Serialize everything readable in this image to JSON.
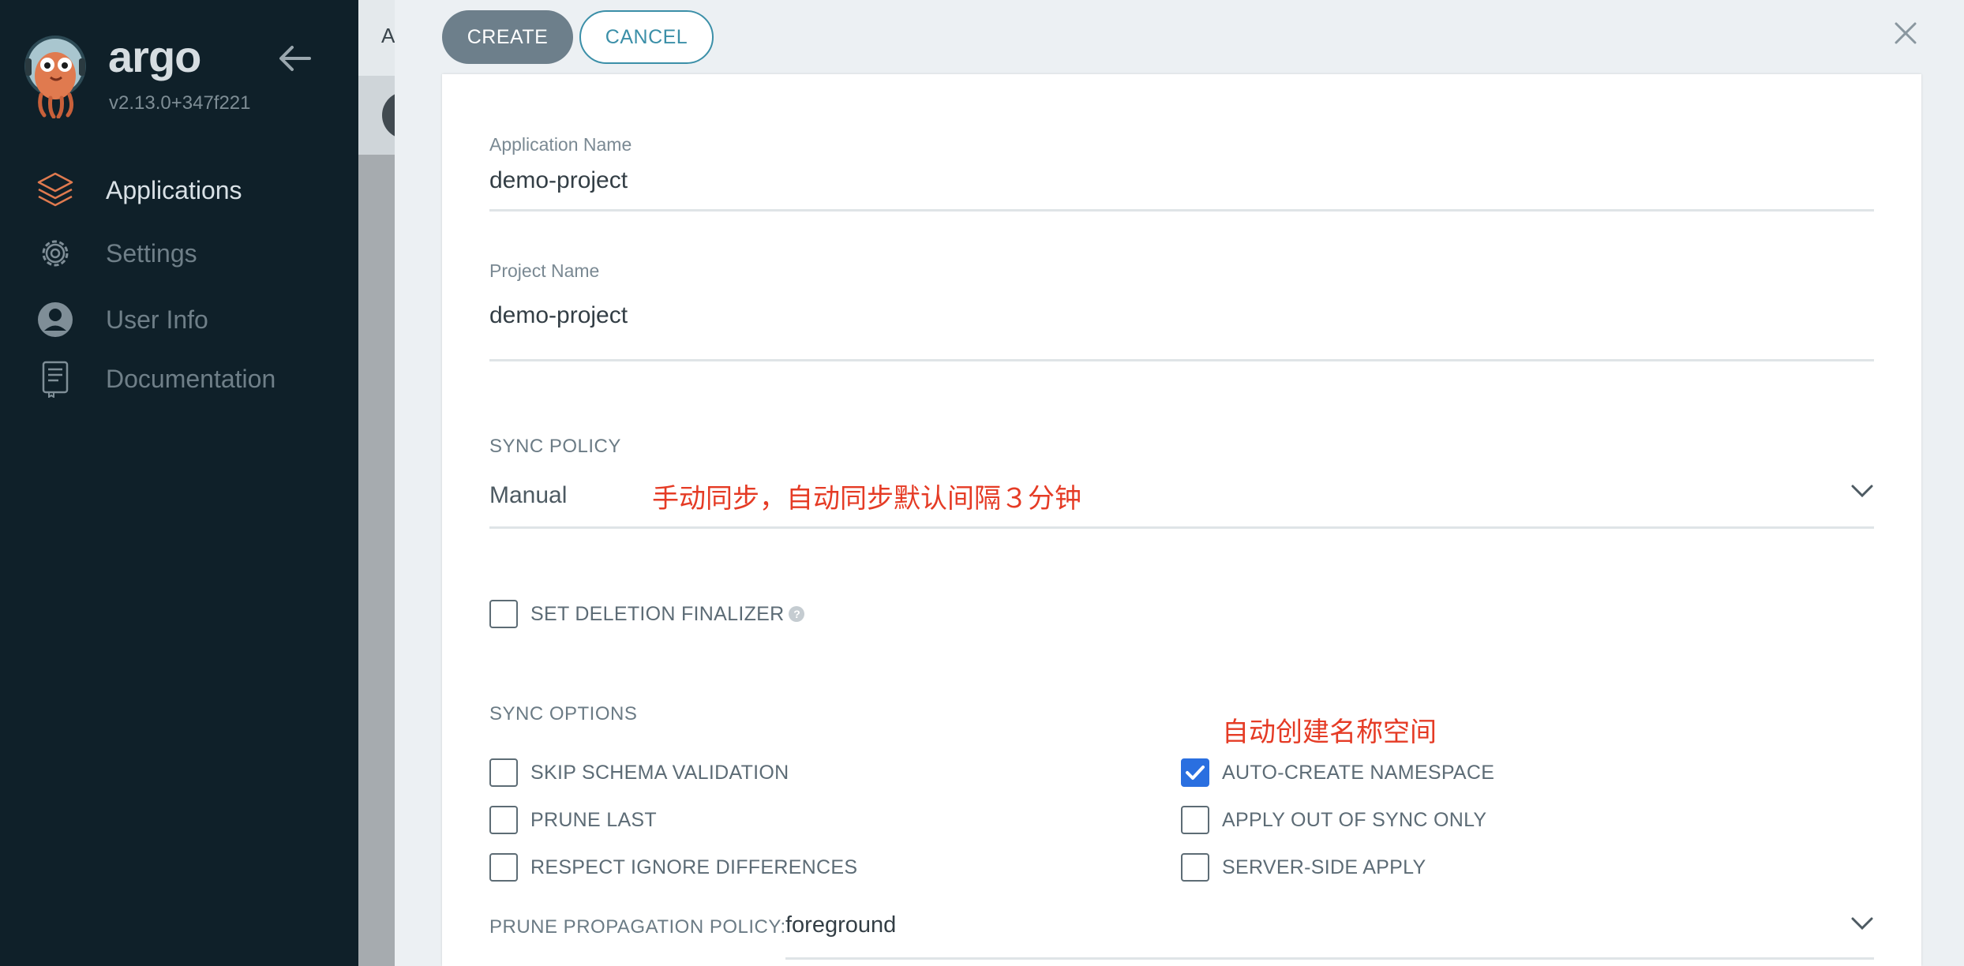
{
  "sidebar": {
    "brand": "argo",
    "version": "v2.13.0+347f221",
    "items": [
      {
        "label": "Applications",
        "icon": "layers-icon",
        "active": true
      },
      {
        "label": "Settings",
        "icon": "gear-icon",
        "active": false
      },
      {
        "label": "User Info",
        "icon": "user-icon",
        "active": false
      },
      {
        "label": "Documentation",
        "icon": "document-icon",
        "active": false
      }
    ]
  },
  "background": {
    "header_letter": "A"
  },
  "panel": {
    "create_label": "CREATE",
    "cancel_label": "CANCEL"
  },
  "form": {
    "app_name_label": "Application Name",
    "app_name_value": "demo-project",
    "project_label": "Project Name",
    "project_value": "demo-project",
    "sync_policy_label": "SYNC POLICY",
    "sync_policy_value": "Manual",
    "sync_policy_note": "手动同步，自动同步默认间隔３分钟",
    "deletion_finalizer_label": "SET DELETION FINALIZER",
    "help_glyph": "?",
    "sync_options_label": "SYNC OPTIONS",
    "namespace_note": "自动创建名称空间",
    "options_left": [
      {
        "label": "SKIP SCHEMA VALIDATION",
        "checked": false
      },
      {
        "label": "PRUNE LAST",
        "checked": false
      },
      {
        "label": "RESPECT IGNORE DIFFERENCES",
        "checked": false
      }
    ],
    "options_right": [
      {
        "label": "AUTO-CREATE NAMESPACE",
        "checked": true
      },
      {
        "label": "APPLY OUT OF SYNC ONLY",
        "checked": false
      },
      {
        "label": "SERVER-SIDE APPLY",
        "checked": false
      }
    ],
    "prune_policy_label": "PRUNE PROPAGATION POLICY:",
    "prune_policy_value": "foreground"
  },
  "colors": {
    "sidebar_bg": "#0f2029",
    "accent_checkbox": "#2a6fe0",
    "annotation": "#e53b25",
    "create_button": "#6d7f8b",
    "cancel_border": "#3b8fa8"
  }
}
